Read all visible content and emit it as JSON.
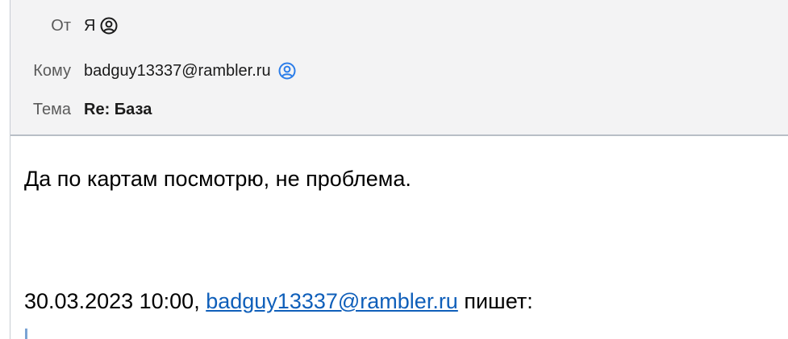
{
  "header": {
    "from_label": "От",
    "from_value": "Я",
    "to_label": "Кому",
    "to_value": "badguy13337@rambler.ru",
    "subject_label": "Тема",
    "subject_value": "Re: База"
  },
  "message": {
    "reply_text": "Да по картам посмотрю, не проблема.",
    "quote_date": "30.03.2023 10:00,",
    "quote_link": "badguy13337@rambler.ru",
    "quote_suffix": "пишет:"
  },
  "icons": {
    "from_icon": "contact-person-icon",
    "to_icon": "contact-person-icon"
  },
  "colors": {
    "header_bg": "#f3f3f4",
    "link": "#0f5fba",
    "to_icon": "#2b7de9",
    "from_icon": "#1b1b1b"
  }
}
